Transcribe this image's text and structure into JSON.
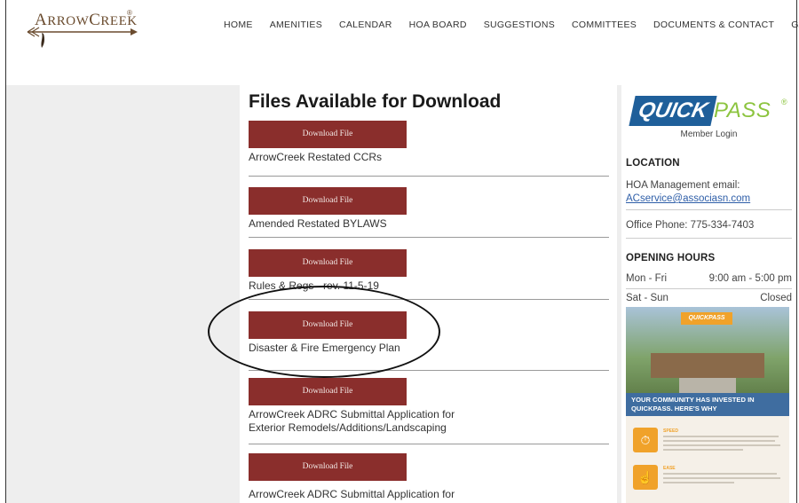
{
  "logo": {
    "text_prefix": "A",
    "text_main": "RROW",
    "text_c": "C",
    "text_end": "REEK",
    "reg": "®"
  },
  "nav": [
    "HOME",
    "AMENITIES",
    "CALENDAR",
    "HOA BOARD",
    "SUGGESTIONS",
    "COMMITTEES",
    "DOCUMENTS & CONTACT",
    "GALLERY"
  ],
  "main": {
    "title": "Files Available for Download",
    "button_label": "Download File",
    "files": [
      {
        "label": "ArrowCreek Restated CCRs"
      },
      {
        "label": "Amended Restated BYLAWS"
      },
      {
        "label": "Rules & Regs - rev. 11-5-19"
      },
      {
        "label": "Disaster & Fire Emergency Plan"
      },
      {
        "label": "ArrowCreek ADRC Submittal Application for Exterior Remodels/Additions/Landscaping"
      },
      {
        "label": "ArrowCreek ADRC Submittal Application for"
      }
    ]
  },
  "sidebar": {
    "quickpass_a": "QUICK",
    "quickpass_b": "PASS",
    "quickpass_reg": "®",
    "member_login": "Member Login",
    "location_heading": "LOCATION",
    "hoa_email_label": "HOA Management email:",
    "hoa_email": "ACservice@associasn.com",
    "office_phone": "Office Phone: 775-334-7403",
    "hours_heading": "OPENING HOURS",
    "hours": [
      {
        "days": "Mon - Fri",
        "time": "9:00 am - 5:00 pm"
      },
      {
        "days": "Sat - Sun",
        "time": "Closed"
      }
    ],
    "promo": {
      "badge": "QUICKPASS",
      "headline": "YOUR COMMUNITY HAS INVESTED IN QUICKPASS. HERE'S WHY",
      "items": [
        {
          "heading": "SPEED"
        },
        {
          "heading": "EASE"
        }
      ]
    }
  },
  "colors": {
    "button_bg": "#8a2e2c",
    "quickpass_blue": "#1f5f9a",
    "quickpass_green": "#8cc43f",
    "link": "#2e5ea8"
  }
}
